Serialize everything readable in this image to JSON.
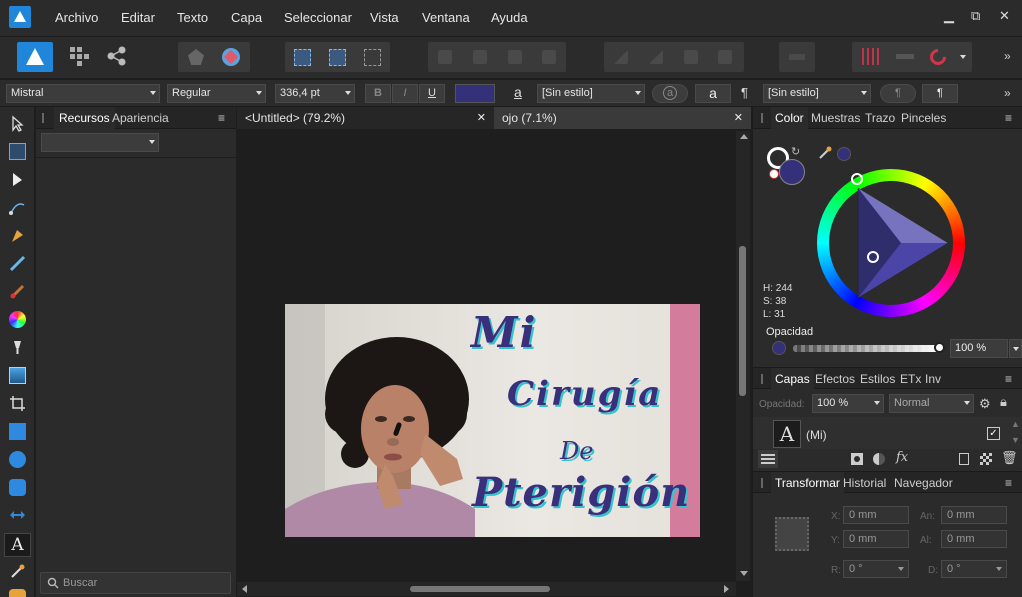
{
  "menu": [
    "Archivo",
    "Editar",
    "Texto",
    "Capa",
    "Seleccionar",
    "Vista",
    "Ventana",
    "Ayuda"
  ],
  "window_controls": {
    "minimize": "▁",
    "restore": "⧉",
    "close": "✕"
  },
  "context": {
    "font_family": "Mistral",
    "font_style": "Regular",
    "font_size": "336,4 pt",
    "bold": "B",
    "italic": "I",
    "underline": "U",
    "char_style_icon": "a",
    "char_style": "[Sin estilo]",
    "para_icon": "¶",
    "para_style": "[Sin estilo]",
    "text_color": "#35307a"
  },
  "left_panel": {
    "tabs": [
      "Recursos",
      "Apariencia"
    ],
    "search_placeholder": "Buscar"
  },
  "documents": [
    {
      "title": "<Untitled> (79.2%)",
      "close": "✕"
    },
    {
      "title": "ojo (7.1%)",
      "close": "✕"
    }
  ],
  "canvas": {
    "words": [
      "Mi",
      "Cirugía",
      "De",
      "Pterigión"
    ],
    "text_color": "#3a2f7a",
    "accent": "#35c3ce",
    "side_bar_color": "#d47c9c"
  },
  "color_panel": {
    "tabs": [
      "Color",
      "Muestras",
      "Trazo",
      "Pinceles"
    ],
    "h": "H: 244",
    "s": "S: 38",
    "l": "L: 31",
    "opacity_label": "Opacidad",
    "opacity_value": "100 %",
    "current_color": "#35307a"
  },
  "layers_panel": {
    "tabs": [
      "Capas",
      "Efectos",
      "Estilos",
      "ETx",
      "Inv"
    ],
    "opacity_label": "Opacidad:",
    "opacity_value": "100 %",
    "blend_mode": "Normal",
    "layer_icon": "A",
    "layer_name": "(Mi)"
  },
  "transform_panel": {
    "tabs": [
      "Transformar",
      "Historial",
      "Navegador"
    ],
    "x_label": "X:",
    "x_value": "0 mm",
    "y_label": "Y:",
    "y_value": "0 mm",
    "w_label": "An:",
    "w_value": "0 mm",
    "h_label": "Al:",
    "h_value": "0 mm",
    "r_label": "R:",
    "r_value": "0 °",
    "s_label": "D:",
    "s_value": "0 °"
  }
}
